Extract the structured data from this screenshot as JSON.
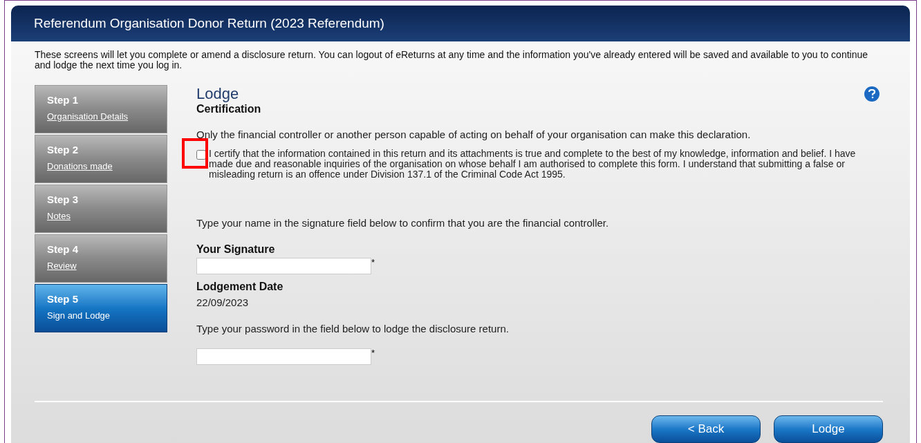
{
  "window": {
    "title": "Referendum Organisation Donor Return (2023 Referendum)"
  },
  "intro": "These screens will let you complete or amend a disclosure return. You can logout of eReturns at any time and the information you've already entered will be saved and available to you to continue and lodge the next time you log in.",
  "steps": [
    {
      "label": "Step 1",
      "link": "Organisation Details",
      "selected": false
    },
    {
      "label": "Step 2",
      "link": "Donations made",
      "selected": false
    },
    {
      "label": "Step 3",
      "link": "Notes",
      "selected": false
    },
    {
      "label": "Step 4",
      "link": "Review",
      "selected": false
    },
    {
      "label": "Step 5",
      "link": "Sign and Lodge",
      "selected": true
    }
  ],
  "heading": "Lodge",
  "subheading": "Certification",
  "note": "Only the financial controller or another person capable of acting on behalf of your organisation can make this declaration.",
  "certification": {
    "checked": false,
    "highlighted": true,
    "text": "I certify that the information contained in this return and its attachments is true and complete to the best of my knowledge, information and belief. I have made due and reasonable inquiries of the organisation on whose behalf I am authorised to complete this form. I understand that submitting a false or misleading return is an offence under Division 137.1 of the Criminal Code Act 1995."
  },
  "signature_instruction": "Type your name in the signature field below to confirm that you are the financial controller.",
  "signature": {
    "label": "Your Signature",
    "required_mark": "*"
  },
  "lodgement_date": {
    "label": "Lodgement Date",
    "value": "22/09/2023"
  },
  "password_instruction": "Type your password in the field below to lodge the disclosure return.",
  "password": {
    "required_mark": "*"
  },
  "buttons": [
    "< Back",
    "Lodge"
  ]
}
